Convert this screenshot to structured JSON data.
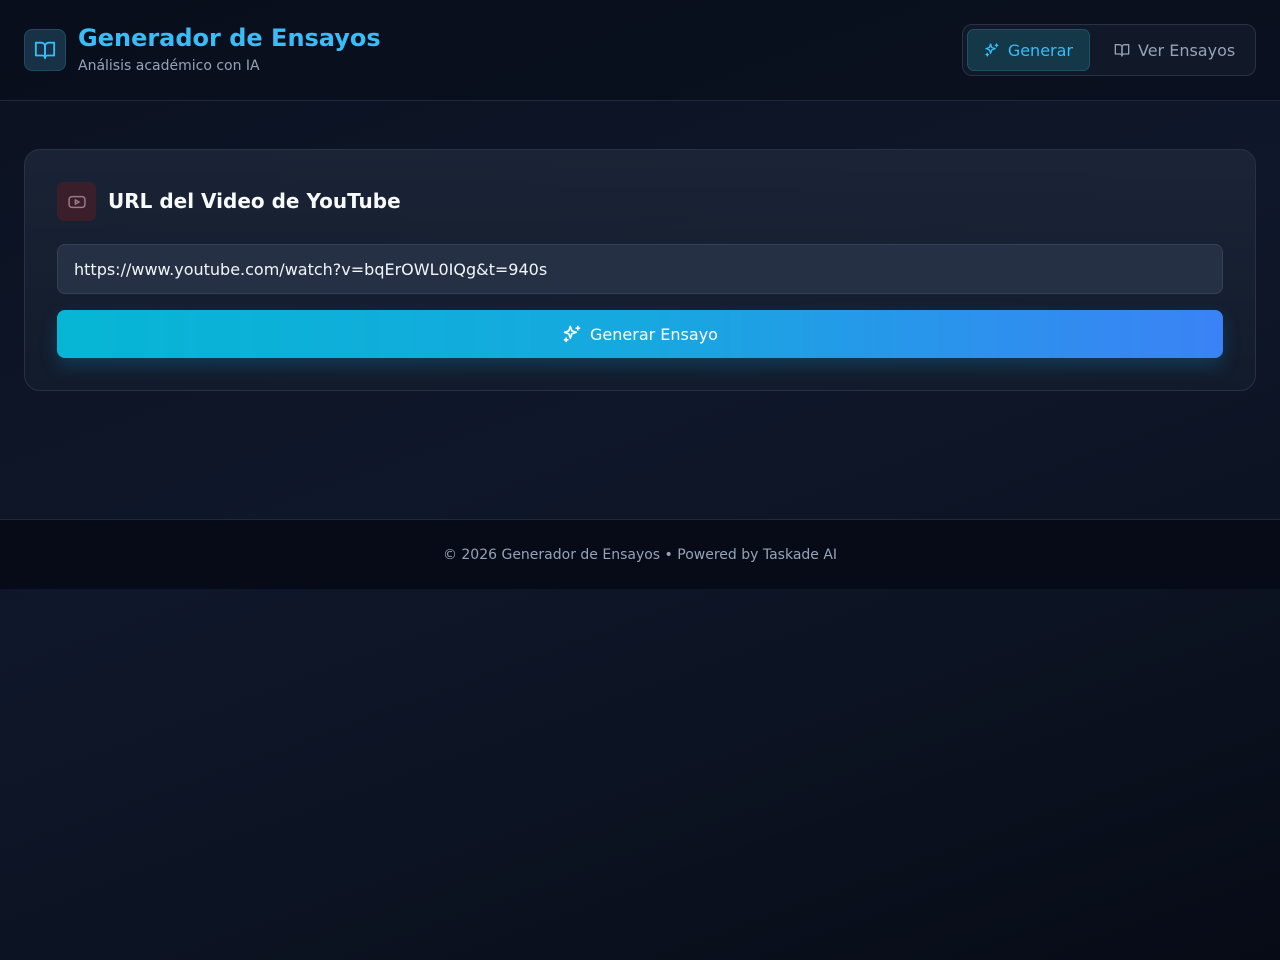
{
  "header": {
    "title": "Generador de Ensayos",
    "subtitle": "Análisis académico con IA",
    "logo_icon": "book-open-icon"
  },
  "nav": {
    "items": [
      {
        "label": "Generar",
        "icon": "sparkles-icon",
        "active": true
      },
      {
        "label": "Ver Ensayos",
        "icon": "book-open-icon",
        "active": false
      }
    ]
  },
  "form": {
    "title": "URL del Video de YouTube",
    "title_icon": "youtube-icon",
    "url_value": "https://www.youtube.com/watch?v=bqErOWL0IQg&t=940s",
    "submit_label": "Generar Ensayo",
    "submit_icon": "sparkles-icon"
  },
  "footer": {
    "text": "© 2026 Generador de Ensayos • Powered by Taskade AI"
  },
  "colors": {
    "accent": "#38bdf8",
    "button_start": "#06b6d4",
    "button_end": "#3b82f6",
    "background": "#0f172a"
  }
}
